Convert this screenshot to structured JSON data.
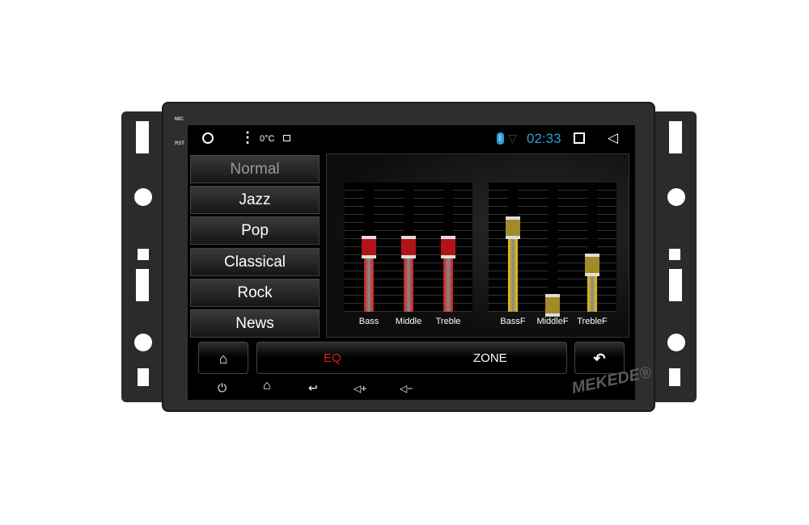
{
  "device": {
    "mic_label": "MIC",
    "rst_label": "RST",
    "brand": "MEKEDE®"
  },
  "status_bar": {
    "circle_icon": "circle-icon",
    "menu_icon": "more-vert-icon",
    "temperature": "0°C",
    "image_icon": "image-icon",
    "bluetooth_icon": "bluetooth-icon",
    "wifi_icon": "wifi-icon",
    "time": "02:33",
    "time_color": "#2a9fd6",
    "recents_icon": "square-icon",
    "back_icon": "triangle-back-icon"
  },
  "presets": [
    {
      "label": "Normal",
      "selected": true
    },
    {
      "label": "Jazz"
    },
    {
      "label": "Pop"
    },
    {
      "label": "Classical"
    },
    {
      "label": "Rock"
    },
    {
      "label": "News"
    }
  ],
  "equalizer": {
    "sliders": [
      {
        "label": "Bass",
        "level": 0.5,
        "color": "#d4161a"
      },
      {
        "label": "Middle",
        "level": 0.5,
        "color": "#d4161a"
      },
      {
        "label": "Treble",
        "level": 0.5,
        "color": "#d4161a"
      },
      {
        "label": "BassF",
        "level": 0.65,
        "color": "#f2c000"
      },
      {
        "label": "MiddleF",
        "level": 0.05,
        "color": "#f2c000"
      },
      {
        "label": "TrebleF",
        "level": 0.36,
        "color": "#f2c000"
      }
    ]
  },
  "bottom_bar": {
    "home_icon": "home-icon",
    "eq_label": "EQ",
    "eq_color": "#e0191c",
    "zone_label": "ZONE",
    "back_icon": "return-icon"
  },
  "hardware_buttons": {
    "power": "⏻",
    "home": "⌂",
    "back": "↩",
    "vol_up": "◁+",
    "vol_down": "◁−"
  }
}
